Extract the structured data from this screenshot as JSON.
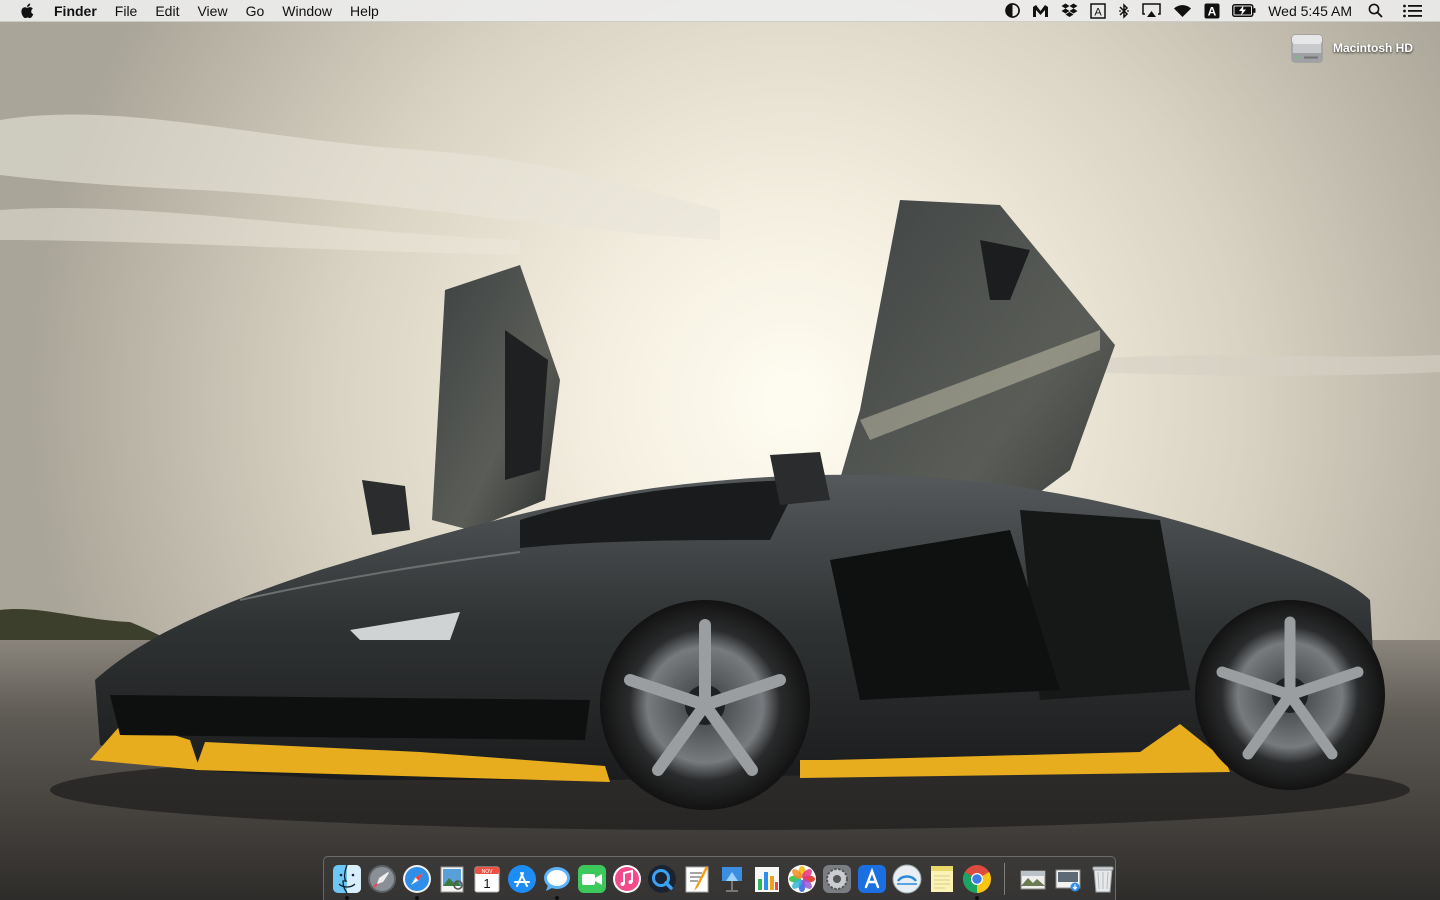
{
  "menubar": {
    "apple_icon": "apple-icon",
    "app_name": "Finder",
    "items": [
      "File",
      "Edit",
      "View",
      "Go",
      "Window",
      "Help"
    ],
    "status_icons": [
      "contrast-icon",
      "m-app-icon",
      "dropbox-icon",
      "font-box-icon",
      "bluetooth-icon",
      "airplay-icon",
      "wifi-icon",
      "input-source-icon",
      "battery-charging-icon"
    ],
    "input_letter": "A",
    "font_letter": "A",
    "clock": "Wed 5:45 AM",
    "search_icon": "spotlight-icon",
    "notification_icon": "notification-center-icon"
  },
  "desktop": {
    "icons": [
      {
        "label": "Macintosh HD",
        "icon": "hard-drive-icon"
      }
    ]
  },
  "dock": {
    "calendar": {
      "month": "NOV",
      "day": "1"
    },
    "apps": [
      {
        "name": "Finder",
        "icon": "finder-icon",
        "running": true
      },
      {
        "name": "Launchpad",
        "icon": "launchpad-icon",
        "running": false
      },
      {
        "name": "Safari",
        "icon": "safari-icon",
        "running": true
      },
      {
        "name": "Preview",
        "icon": "preview-icon",
        "running": false
      },
      {
        "name": "Calendar",
        "icon": "calendar-icon",
        "running": false
      },
      {
        "name": "App Store",
        "icon": "app-store-icon",
        "running": false
      },
      {
        "name": "Messages",
        "icon": "messages-icon",
        "running": true
      },
      {
        "name": "FaceTime",
        "icon": "facetime-icon",
        "running": false
      },
      {
        "name": "iTunes",
        "icon": "itunes-icon",
        "running": false
      },
      {
        "name": "QuickTime Player",
        "icon": "quicktime-icon",
        "running": false
      },
      {
        "name": "Pages",
        "icon": "pages-icon",
        "running": false
      },
      {
        "name": "Keynote",
        "icon": "keynote-icon",
        "running": false
      },
      {
        "name": "Numbers",
        "icon": "numbers-icon",
        "running": false
      },
      {
        "name": "Photos",
        "icon": "photos-icon",
        "running": false
      },
      {
        "name": "System Preferences",
        "icon": "system-preferences-icon",
        "running": false
      },
      {
        "name": "Xcode",
        "icon": "xcode-icon",
        "running": false
      },
      {
        "name": "Network Utility",
        "icon": "network-icon",
        "running": false
      },
      {
        "name": "Notes",
        "icon": "notes-icon",
        "running": false
      },
      {
        "name": "Google Chrome",
        "icon": "chrome-icon",
        "running": true
      }
    ],
    "stacks": [
      {
        "name": "Documents",
        "icon": "documents-stack-icon"
      },
      {
        "name": "Downloads",
        "icon": "downloads-stack-icon"
      },
      {
        "name": "Trash",
        "icon": "trash-icon"
      }
    ]
  },
  "colors": {
    "menubar_bg": "#ececec",
    "sky_top": "#b8b4a8",
    "sky_glow": "#fffbe8",
    "car_body": "#2b2d2e",
    "car_accent": "#e8ad1f",
    "asphalt": "#4a4642"
  }
}
